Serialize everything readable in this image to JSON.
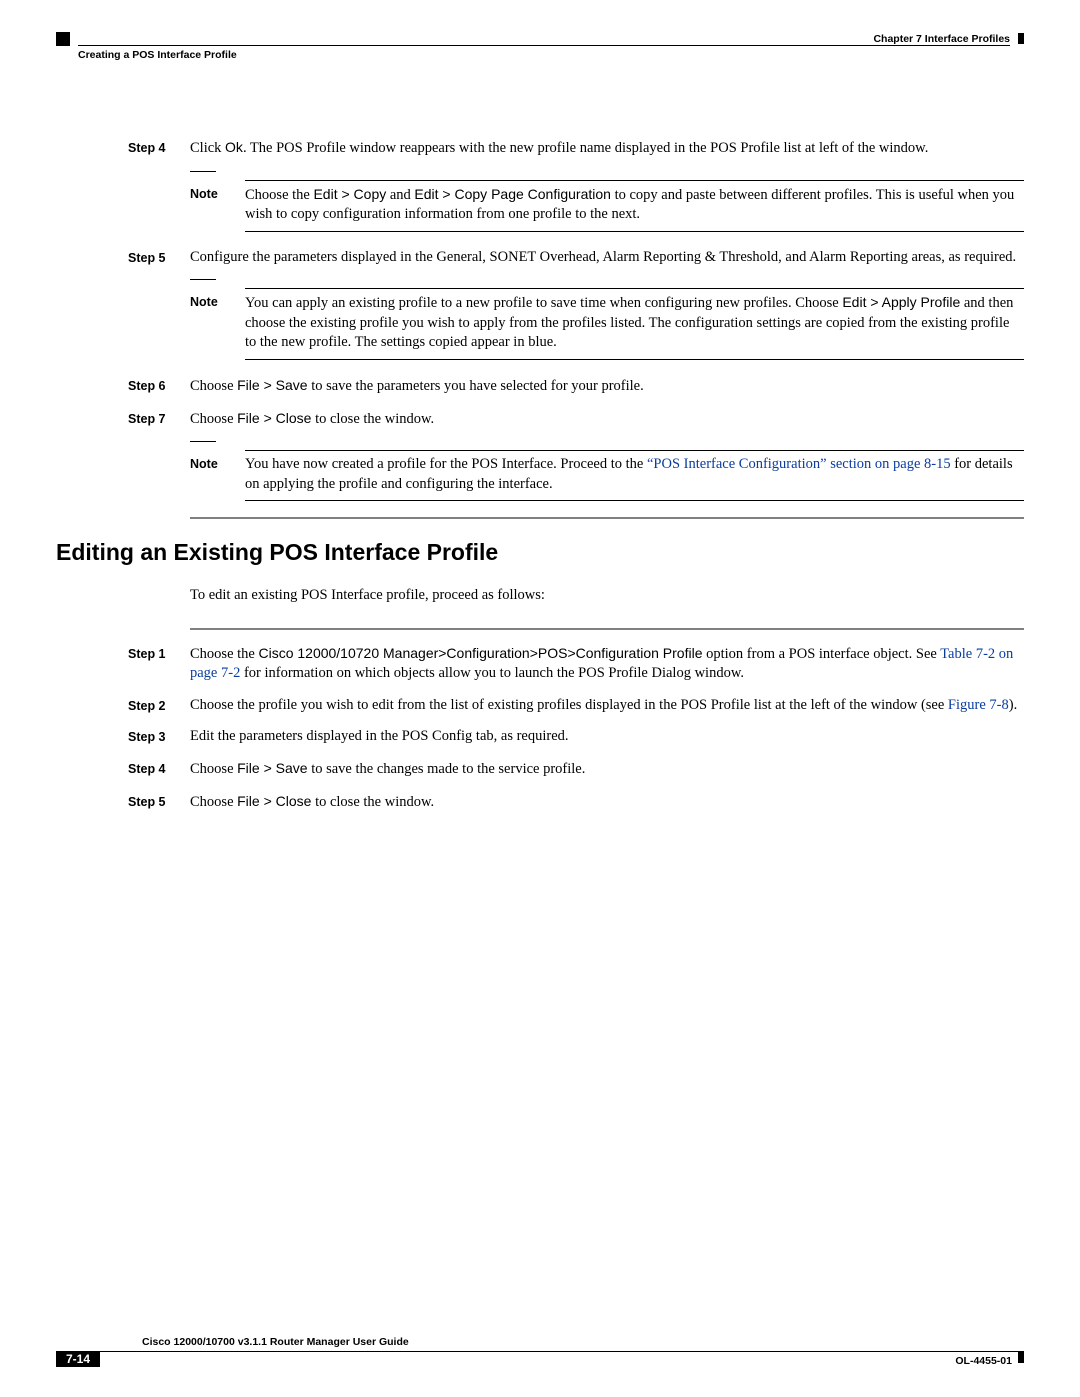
{
  "header": {
    "chapter": "Chapter 7    Interface Profiles",
    "section": "Creating a POS Interface Profile"
  },
  "steps1": [
    {
      "n": "Step 4",
      "parts": [
        {
          "t": "Click "
        },
        {
          "t": "Ok",
          "sans": true
        },
        {
          "t": ". The POS Profile window reappears with the new profile name displayed in the POS Profile list at left of the window."
        }
      ],
      "note": {
        "parts": [
          {
            "t": "Choose the "
          },
          {
            "t": "Edit > Copy",
            "sans": true
          },
          {
            "t": " and "
          },
          {
            "t": "Edit > Copy Page Configuration",
            "sans": true
          },
          {
            "t": " to copy and paste between different profiles. This is useful when you wish to copy configuration information from one profile to the next."
          }
        ]
      }
    },
    {
      "n": "Step 5",
      "parts": [
        {
          "t": "Configure the parameters displayed in the General, SONET Overhead, Alarm Reporting & Threshold, and Alarm Reporting areas, as required."
        }
      ],
      "note": {
        "parts": [
          {
            "t": "You can apply an existing profile to a new profile to save time when configuring new profiles. Choose "
          },
          {
            "t": "Edit > Apply Profile",
            "sans": true
          },
          {
            "t": " and then choose the existing profile you wish to apply from the profiles listed. The configuration settings are copied from the existing profile to the new profile. The settings copied appear in blue."
          }
        ]
      }
    },
    {
      "n": "Step 6",
      "parts": [
        {
          "t": "Choose "
        },
        {
          "t": "File > Save",
          "sans": true
        },
        {
          "t": " to save the parameters you have selected for your profile."
        }
      ]
    },
    {
      "n": "Step 7",
      "parts": [
        {
          "t": "Choose "
        },
        {
          "t": "File > Close",
          "sans": true
        },
        {
          "t": " to close the window."
        }
      ],
      "note": {
        "parts": [
          {
            "t": "You have now created a profile for the POS Interface. Proceed to the "
          },
          {
            "t": "“POS Interface Configuration” section on page 8-15",
            "link": true
          },
          {
            "t": " for details on applying the profile and configuring the interface."
          }
        ]
      }
    }
  ],
  "h2": "Editing an Existing POS Interface Profile",
  "intro": "To edit an existing POS Interface profile, proceed as follows:",
  "steps2": [
    {
      "n": "Step 1",
      "parts": [
        {
          "t": "Choose the "
        },
        {
          "t": "Cisco 12000/10720 Manager>Configuration>POS>Configuration Profile",
          "sans": true
        },
        {
          "t": " option from a POS interface object. See "
        },
        {
          "t": "Table 7-2 on page 7-2",
          "link": true
        },
        {
          "t": " for information on which objects allow you to launch the POS Profile Dialog window."
        }
      ]
    },
    {
      "n": "Step 2",
      "parts": [
        {
          "t": "Choose the profile you wish to edit from the list of existing profiles displayed in the POS Profile list at the left of the window (see "
        },
        {
          "t": "Figure 7-8",
          "link": true
        },
        {
          "t": ")."
        }
      ]
    },
    {
      "n": "Step 3",
      "parts": [
        {
          "t": "Edit the parameters displayed in the POS Config tab, as required."
        }
      ]
    },
    {
      "n": "Step 4",
      "parts": [
        {
          "t": "Choose "
        },
        {
          "t": "File > Save",
          "sans": true
        },
        {
          "t": " to save the changes made to the service profile."
        }
      ]
    },
    {
      "n": "Step 5",
      "parts": [
        {
          "t": "Choose "
        },
        {
          "t": "File > Close",
          "sans": true
        },
        {
          "t": " to close the window."
        }
      ]
    }
  ],
  "footer": {
    "guide": "Cisco 12000/10700 v3.1.1 Router Manager User Guide",
    "page": "7-14",
    "doc": "OL-4455-01"
  },
  "labels": {
    "note": "Note"
  }
}
